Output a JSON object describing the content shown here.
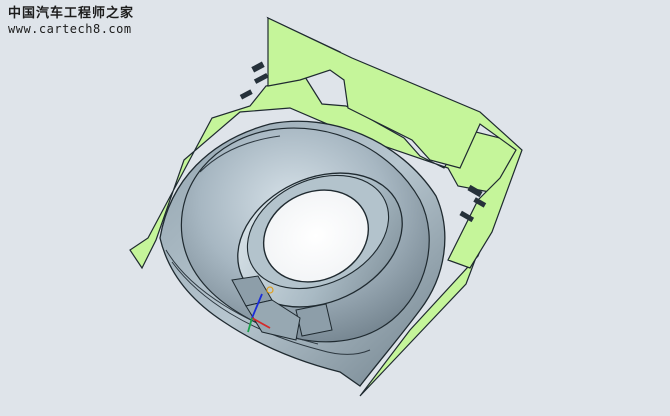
{
  "watermark": {
    "title": "中国汽车工程师之家",
    "url": "www.cartech8.com"
  },
  "colors": {
    "background": "#dfe4ea",
    "section_face": "#c5f59a",
    "metal": "#a9b9c4",
    "edge": "#1f2a30"
  }
}
